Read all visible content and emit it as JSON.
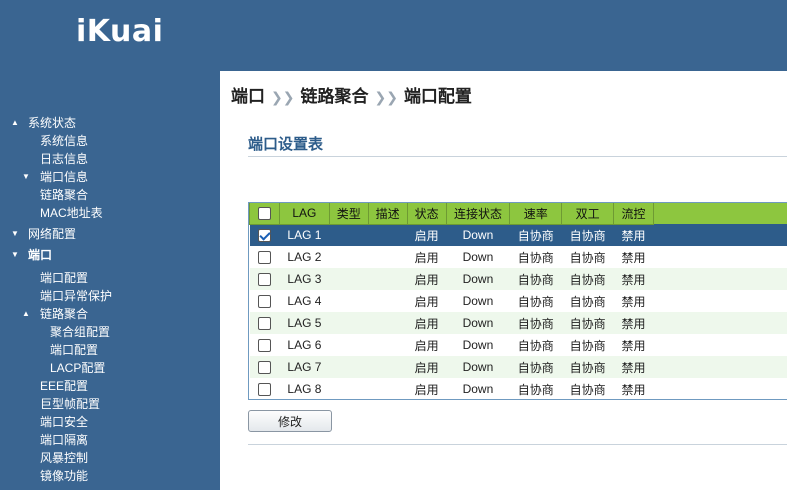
{
  "header": {
    "logo": "iKuai"
  },
  "sidebar": {
    "items": [
      {
        "label": "系统状态",
        "caret": "▲",
        "level": 0,
        "bold": false
      },
      {
        "label": "系统信息",
        "caret": "",
        "level": 1,
        "bold": false
      },
      {
        "label": "日志信息",
        "caret": "",
        "level": 1,
        "bold": false
      },
      {
        "label": "端口信息",
        "caret": "▼",
        "level": 1,
        "bold": false
      },
      {
        "label": "链路聚合",
        "caret": "",
        "level": 1,
        "bold": false
      },
      {
        "label": "MAC地址表",
        "caret": "",
        "level": 1,
        "bold": false
      },
      {
        "label": "网络配置",
        "caret": "▼",
        "level": 0,
        "bold": false
      },
      {
        "label": "端口",
        "caret": "▼",
        "level": 0,
        "bold": true
      },
      {
        "label": "端口配置",
        "caret": "",
        "level": 1,
        "bold": false
      },
      {
        "label": "端口异常保护",
        "caret": "",
        "level": 1,
        "bold": false
      },
      {
        "label": "链路聚合",
        "caret": "▲",
        "level": 1,
        "bold": false
      },
      {
        "label": "聚合组配置",
        "caret": "",
        "level": 2,
        "bold": false
      },
      {
        "label": "端口配置",
        "caret": "",
        "level": 2,
        "bold": false
      },
      {
        "label": "LACP配置",
        "caret": "",
        "level": 2,
        "bold": false
      },
      {
        "label": "EEE配置",
        "caret": "",
        "level": 1,
        "bold": false
      },
      {
        "label": "巨型帧配置",
        "caret": "",
        "level": 1,
        "bold": false
      },
      {
        "label": "端口安全",
        "caret": "",
        "level": 1,
        "bold": false
      },
      {
        "label": "端口隔离",
        "caret": "",
        "level": 1,
        "bold": false
      },
      {
        "label": "风暴控制",
        "caret": "",
        "level": 1,
        "bold": false
      },
      {
        "label": "镜像功能",
        "caret": "",
        "level": 1,
        "bold": false
      }
    ]
  },
  "breadcrumb": {
    "part1": "端口",
    "part2": "链路聚合",
    "part3": "端口配置",
    "sep": "❯❯"
  },
  "section": {
    "title": "端口设置表"
  },
  "table": {
    "headers": [
      "LAG",
      "类型",
      "描述",
      "状态",
      "连接状态",
      "速率",
      "双工",
      "流控"
    ],
    "rows": [
      {
        "checked": true,
        "cells": [
          "LAG 1",
          "",
          "",
          "启用",
          "Down",
          "自协商",
          "自协商",
          "禁用"
        ]
      },
      {
        "checked": false,
        "cells": [
          "LAG 2",
          "",
          "",
          "启用",
          "Down",
          "自协商",
          "自协商",
          "禁用"
        ]
      },
      {
        "checked": false,
        "cells": [
          "LAG 3",
          "",
          "",
          "启用",
          "Down",
          "自协商",
          "自协商",
          "禁用"
        ]
      },
      {
        "checked": false,
        "cells": [
          "LAG 4",
          "",
          "",
          "启用",
          "Down",
          "自协商",
          "自协商",
          "禁用"
        ]
      },
      {
        "checked": false,
        "cells": [
          "LAG 5",
          "",
          "",
          "启用",
          "Down",
          "自协商",
          "自协商",
          "禁用"
        ]
      },
      {
        "checked": false,
        "cells": [
          "LAG 6",
          "",
          "",
          "启用",
          "Down",
          "自协商",
          "自协商",
          "禁用"
        ]
      },
      {
        "checked": false,
        "cells": [
          "LAG 7",
          "",
          "",
          "启用",
          "Down",
          "自协商",
          "自协商",
          "禁用"
        ]
      },
      {
        "checked": false,
        "cells": [
          "LAG 8",
          "",
          "",
          "启用",
          "Down",
          "自协商",
          "自协商",
          "禁用"
        ]
      }
    ]
  },
  "buttons": {
    "modify": "修改"
  },
  "colors": {
    "brand": "#3a6591",
    "header_green": "#8dc63f",
    "selected_row": "#2d5c8a",
    "title_blue": "#2d5c8a"
  }
}
